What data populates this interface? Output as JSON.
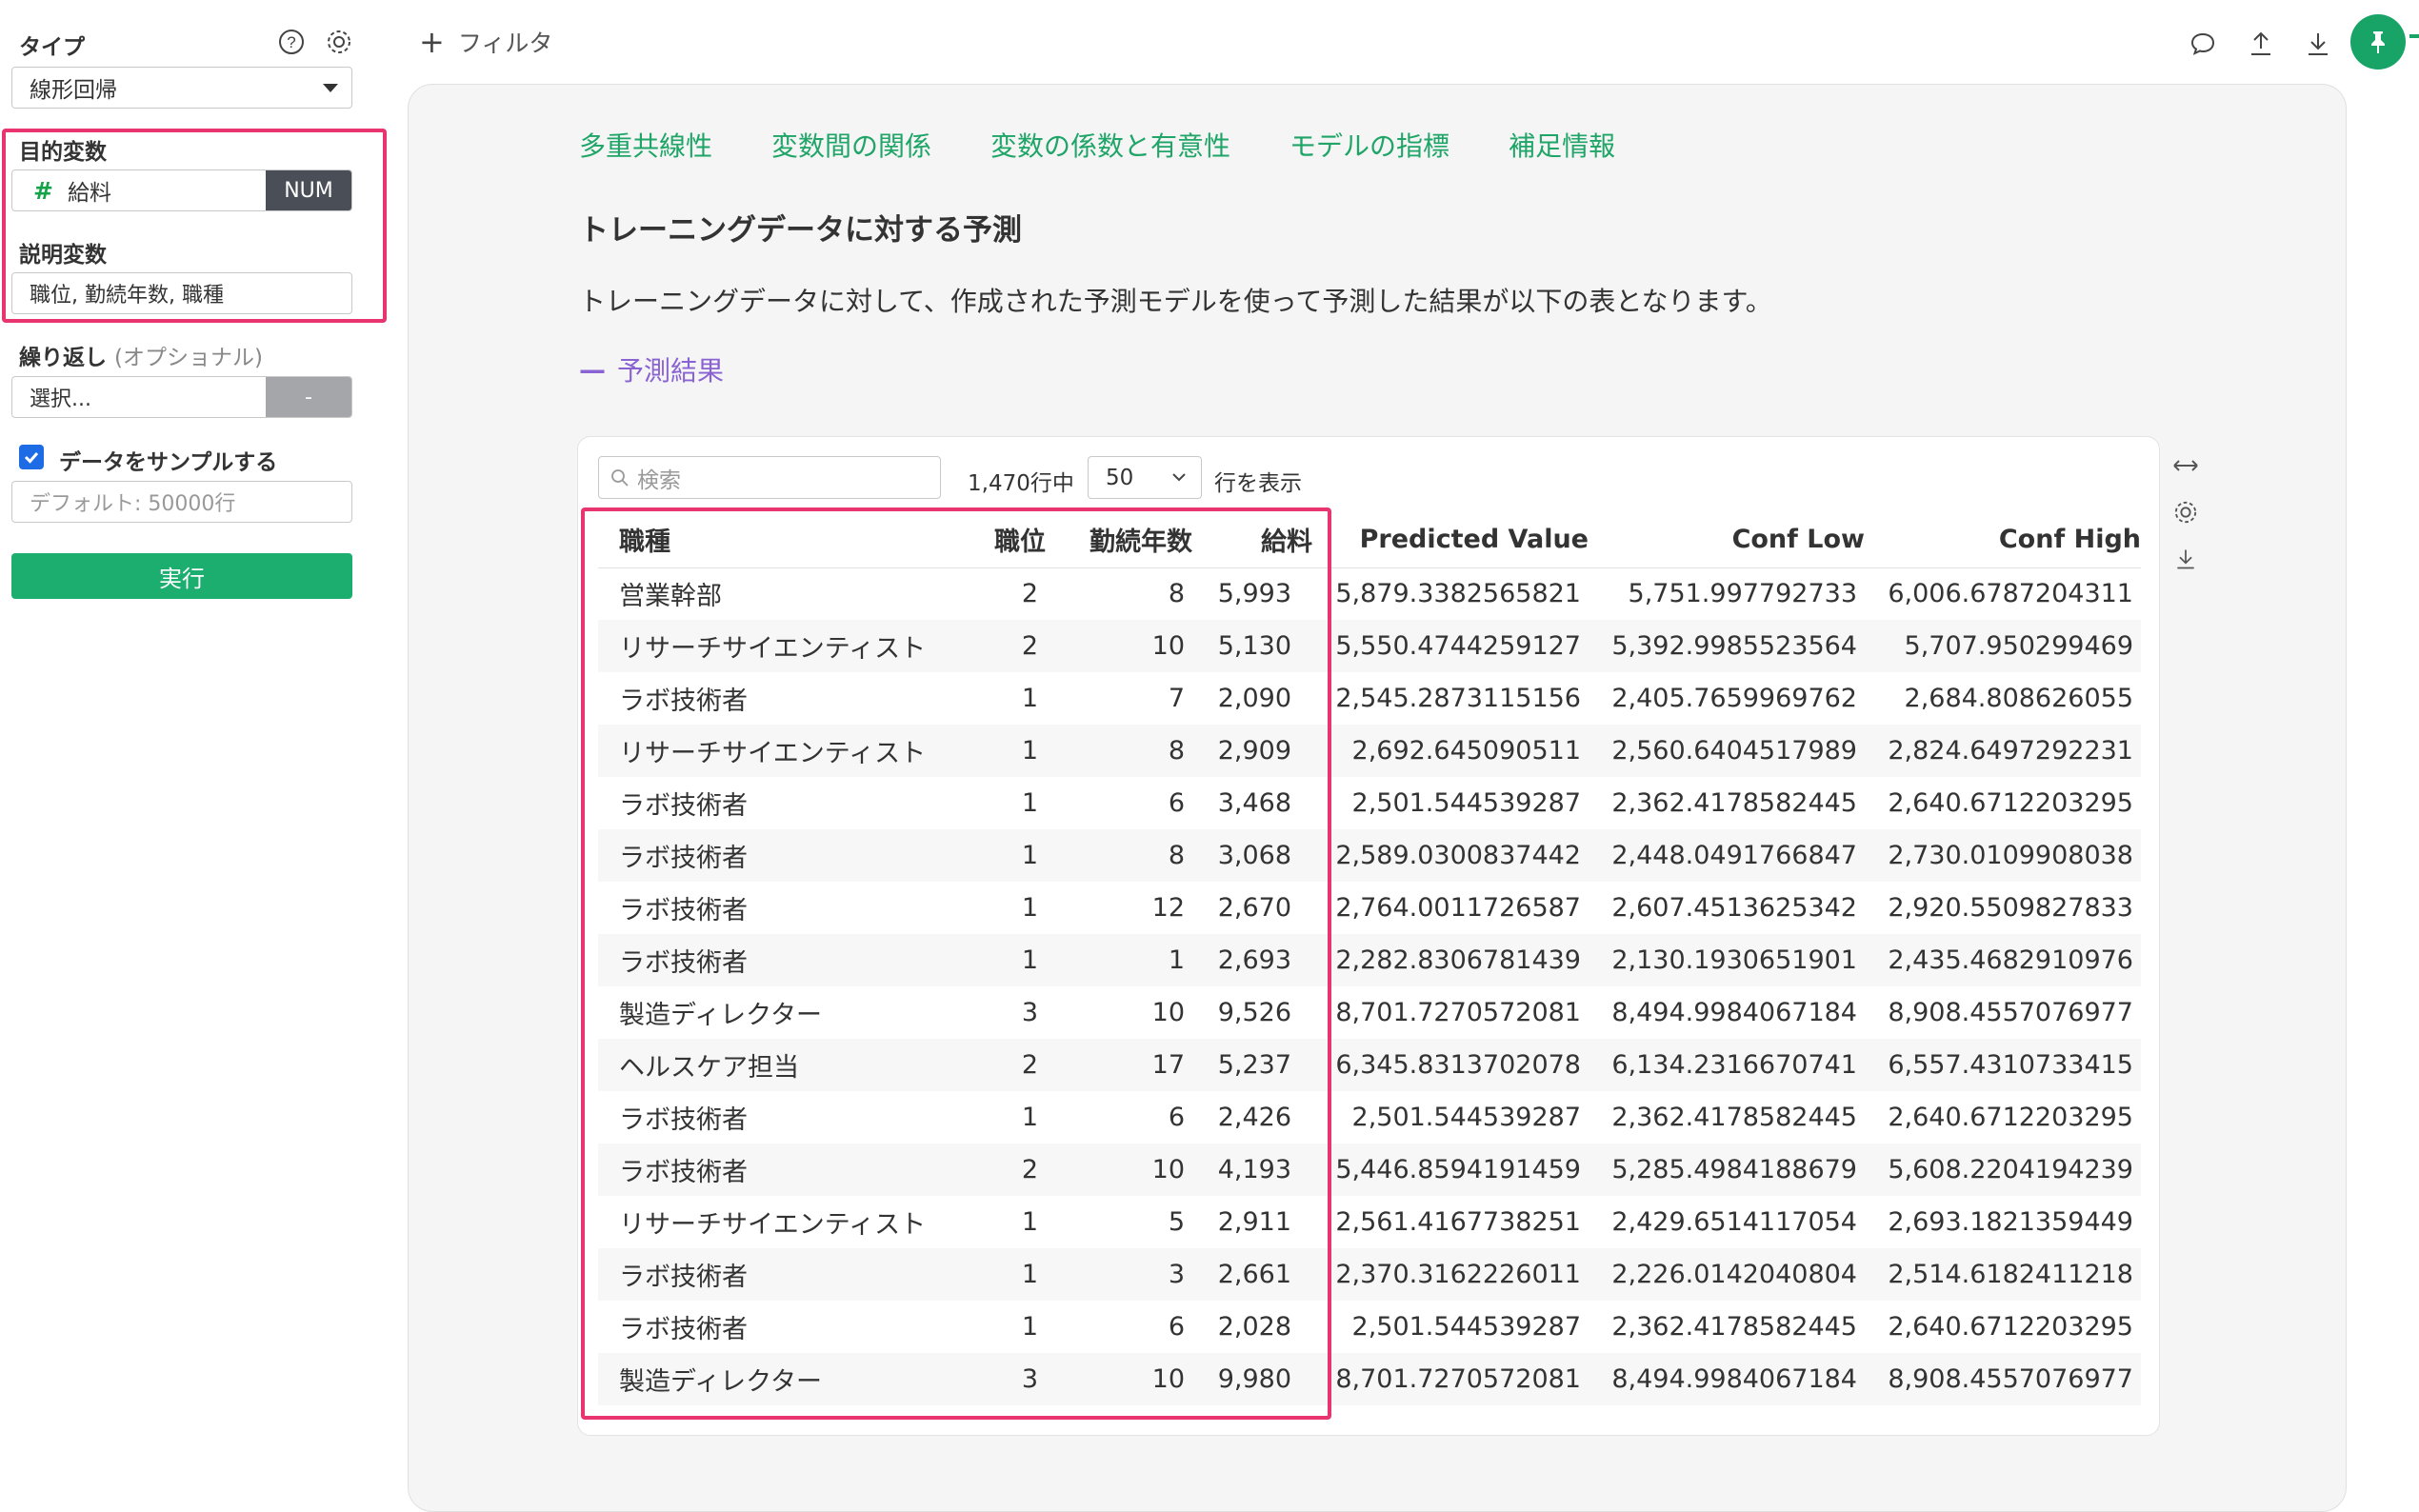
{
  "sidebar": {
    "type_label": "タイプ",
    "type_value": "線形回帰",
    "target_label": "目的変数",
    "target_value": "給料",
    "target_badge": "NUM",
    "explanatory_label": "説明変数",
    "explanatory_value": "職位, 勤続年数, 職種",
    "repeat_label": "繰り返し",
    "repeat_optional": "(オプショナル)",
    "repeat_value": "選択...",
    "repeat_button": "-",
    "sample_label": "データをサンプルする",
    "sample_checked": true,
    "sample_placeholder": "デフォルト: 50000行",
    "run_label": "実行"
  },
  "topbar": {
    "filter_label": "フィルタ",
    "icons": [
      "comment-icon",
      "upload-icon",
      "download-icon",
      "pin-icon"
    ]
  },
  "main": {
    "tabs": [
      "多重共線性",
      "変数間の関係",
      "変数の係数と有意性",
      "モデルの指標",
      "補足情報"
    ],
    "section_title": "トレーニングデータに対する予測",
    "description": "トレーニングデータに対して、作成された予測モデルを使って予測した結果が以下の表となります。",
    "collapse_label": "予測結果",
    "table_controls": {
      "search_placeholder": "検索",
      "rows_count": "1,470行中",
      "rows_per_page": "50",
      "rows_suffix": "行を表示"
    },
    "columns": [
      "職種",
      "職位",
      "勤続年数",
      "給料",
      "Predicted Value",
      "Conf Low",
      "Conf High"
    ],
    "rows": [
      [
        "営業幹部",
        "2",
        "8",
        "5,993",
        "5,879.3382565821",
        "5,751.997792733",
        "6,006.6787204311"
      ],
      [
        "リサーチサイエンティスト",
        "2",
        "10",
        "5,130",
        "5,550.4744259127",
        "5,392.9985523564",
        "5,707.950299469"
      ],
      [
        "ラボ技術者",
        "1",
        "7",
        "2,090",
        "2,545.2873115156",
        "2,405.7659969762",
        "2,684.808626055"
      ],
      [
        "リサーチサイエンティスト",
        "1",
        "8",
        "2,909",
        "2,692.645090511",
        "2,560.6404517989",
        "2,824.6497292231"
      ],
      [
        "ラボ技術者",
        "1",
        "6",
        "3,468",
        "2,501.544539287",
        "2,362.4178582445",
        "2,640.6712203295"
      ],
      [
        "ラボ技術者",
        "1",
        "8",
        "3,068",
        "2,589.0300837442",
        "2,448.0491766847",
        "2,730.0109908038"
      ],
      [
        "ラボ技術者",
        "1",
        "12",
        "2,670",
        "2,764.0011726587",
        "2,607.4513625342",
        "2,920.5509827833"
      ],
      [
        "ラボ技術者",
        "1",
        "1",
        "2,693",
        "2,282.8306781439",
        "2,130.1930651901",
        "2,435.4682910976"
      ],
      [
        "製造ディレクター",
        "3",
        "10",
        "9,526",
        "8,701.7270572081",
        "8,494.9984067184",
        "8,908.4557076977"
      ],
      [
        "ヘルスケア担当",
        "2",
        "17",
        "5,237",
        "6,345.8313702078",
        "6,134.2316670741",
        "6,557.4310733415"
      ],
      [
        "ラボ技術者",
        "1",
        "6",
        "2,426",
        "2,501.544539287",
        "2,362.4178582445",
        "2,640.6712203295"
      ],
      [
        "ラボ技術者",
        "2",
        "10",
        "4,193",
        "5,446.8594191459",
        "5,285.4984188679",
        "5,608.2204194239"
      ],
      [
        "リサーチサイエンティスト",
        "1",
        "5",
        "2,911",
        "2,561.4167738251",
        "2,429.6514117054",
        "2,693.1821359449"
      ],
      [
        "ラボ技術者",
        "1",
        "3",
        "2,661",
        "2,370.3162226011",
        "2,226.0142040804",
        "2,514.6182411218"
      ],
      [
        "ラボ技術者",
        "1",
        "6",
        "2,028",
        "2,501.544539287",
        "2,362.4178582445",
        "2,640.6712203295"
      ],
      [
        "製造ディレクター",
        "3",
        "10",
        "9,980",
        "8,701.7270572081",
        "8,494.9984067184",
        "8,908.4557076977"
      ]
    ]
  },
  "colors": {
    "accent_green": "#1cae6f",
    "tab_green": "#1fa567",
    "highlight_pink": "#e8356f",
    "collapse_purple": "#8a63d2"
  }
}
